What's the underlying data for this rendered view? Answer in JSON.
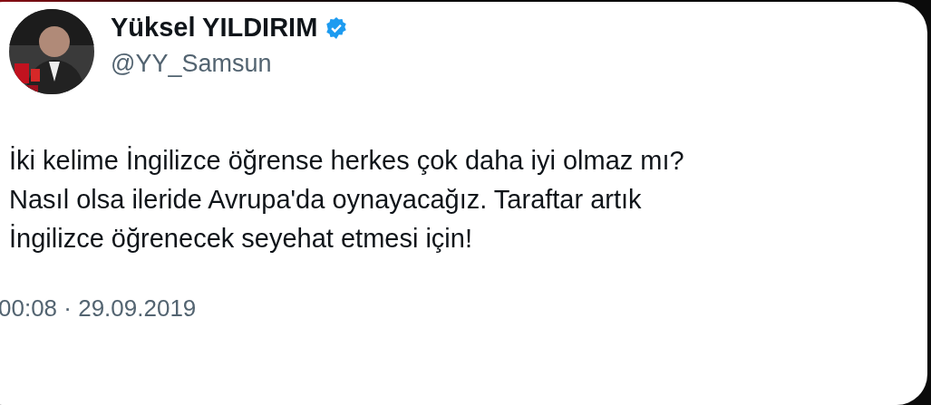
{
  "tweet": {
    "author": {
      "name": "Yüksel YILDIRIM",
      "handle": "@YY_Samsun",
      "verified": true
    },
    "text": [
      "İki kelime İngilizce öğrense herkes çok daha iyi olmaz mı?",
      "Nasıl olsa ileride Avrupa'da oynayacağız. Taraftar artık",
      "İngilizce öğrenecek seyehat etmesi için!"
    ],
    "timestamp": "00:08 · 29.09.2019"
  }
}
